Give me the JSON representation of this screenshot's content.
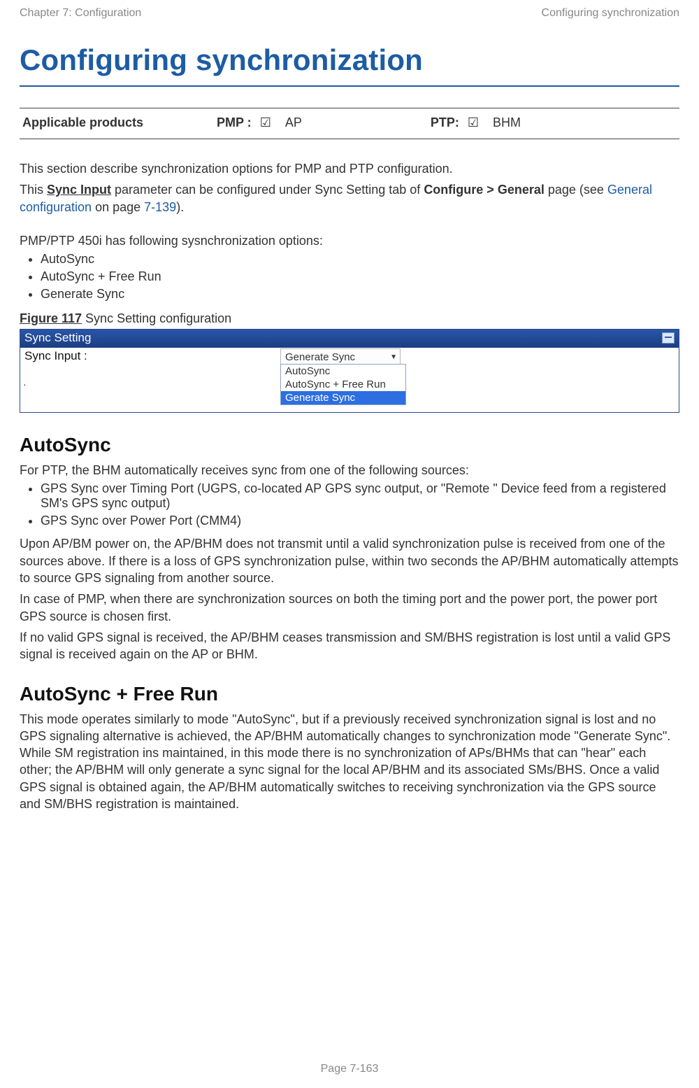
{
  "header": {
    "left": "Chapter 7:  Configuration",
    "right": "Configuring synchronization"
  },
  "title": "Configuring synchronization",
  "products": {
    "label": "Applicable products",
    "pmp_label": "PMP :",
    "pmp_check": "☑",
    "pmp_value": "AP",
    "ptp_label": "PTP:",
    "ptp_check": "☑",
    "ptp_value": "BHM"
  },
  "intro": {
    "p1": "This section describe synchronization options for PMP and PTP configuration.",
    "p2_pre": "This ",
    "p2_bold1": "Sync Input",
    "p2_mid": " parameter can be configured under Sync Setting tab of ",
    "p2_bold2": "Configure > General",
    "p2_post": " page (see ",
    "p2_link": "General configuration",
    "p2_after": " on page ",
    "p2_page": "7-139",
    "p2_close": ")."
  },
  "options": {
    "lead": "PMP/PTP 450i has following sysnchronization options:",
    "items": [
      "AutoSync",
      "AutoSync + Free Run",
      "Generate Sync"
    ]
  },
  "figure": {
    "label": "Figure 117",
    "caption": " Sync Setting configuration"
  },
  "sync_panel": {
    "title": "Sync Setting",
    "field": "Sync Input :",
    "selected": "Generate Sync",
    "options": [
      "AutoSync",
      "AutoSync + Free Run",
      "Generate Sync"
    ]
  },
  "autosync": {
    "heading": "AutoSync",
    "p1": "For PTP, the BHM automatically receives sync from one of the following sources:",
    "items": [
      "GPS Sync over Timing Port (UGPS, co-located AP GPS sync output, or \"Remote \" Device feed from a registered SM's GPS sync output)",
      "GPS Sync over Power Port (CMM4)"
    ],
    "p2": "Upon AP/BM power on, the AP/BHM does not transmit until a valid synchronization pulse is received from one of the sources above. If there is a loss of GPS synchronization pulse, within two seconds the AP/BHM automatically attempts to source GPS signaling from another source.",
    "p3": "In case of PMP, when there are synchronization sources on both the timing port and the power port, the power port GPS source is chosen first.",
    "p4": "If no valid GPS signal is received, the AP/BHM ceases transmission and SM/BHS registration is lost until a valid GPS signal is received again on the AP or BHM."
  },
  "freerun": {
    "heading": "AutoSync + Free Run",
    "p1": "This mode operates similarly to mode \"AutoSync\", but if a previously received synchronization signal is lost and no GPS signaling alternative is achieved, the AP/BHM automatically changes to synchronization mode \"Generate Sync\". While SM registration ins maintained, in this mode there is no synchronization of APs/BHMs that can \"hear\" each other; the AP/BHM will only generate a sync signal for the local AP/BHM and its associated SMs/BHS. Once a valid GPS signal is obtained again, the AP/BHM automatically switches to receiving synchronization via the GPS source and SM/BHS registration is maintained."
  },
  "footer": {
    "page": "Page 7-163"
  }
}
